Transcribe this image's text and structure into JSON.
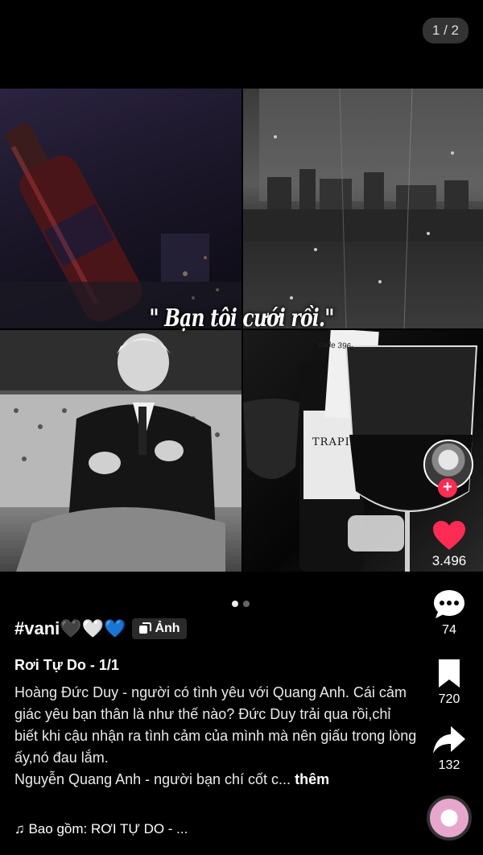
{
  "page_indicator": "1 / 2",
  "caption": "\" Bạn tôi cưới rồi.\"",
  "bottle_label": "code 396-",
  "wine_label": "TRAPIC",
  "carousel": {
    "dots": 2,
    "active": 0
  },
  "actions": {
    "like_count": "3.496",
    "comment_count": "74",
    "bookmark_count": "720",
    "share_count": "132"
  },
  "post": {
    "hashtag": "#vani🖤🤍💙",
    "badge_label": "Ảnh",
    "title": "Rơi Tự Do - 1/1",
    "description": "Hoàng Đức Duy - người có tình yêu với Quang Anh. Cái cảm giác yêu bạn thân là như thế nào? Đức Duy trải qua rồi,chỉ biết khi cậu nhận ra tình cảm của mình mà nên giấu trong lòng ấy,nó đau lắm.",
    "description2": "Nguyễn Quang Anh - người bạn chí cốt c...",
    "more_label": "thêm"
  },
  "music": "♫ Bao gồm: RƠI TỰ DO - ...",
  "colors": {
    "like": "#fe2c55",
    "background": "#000000"
  }
}
